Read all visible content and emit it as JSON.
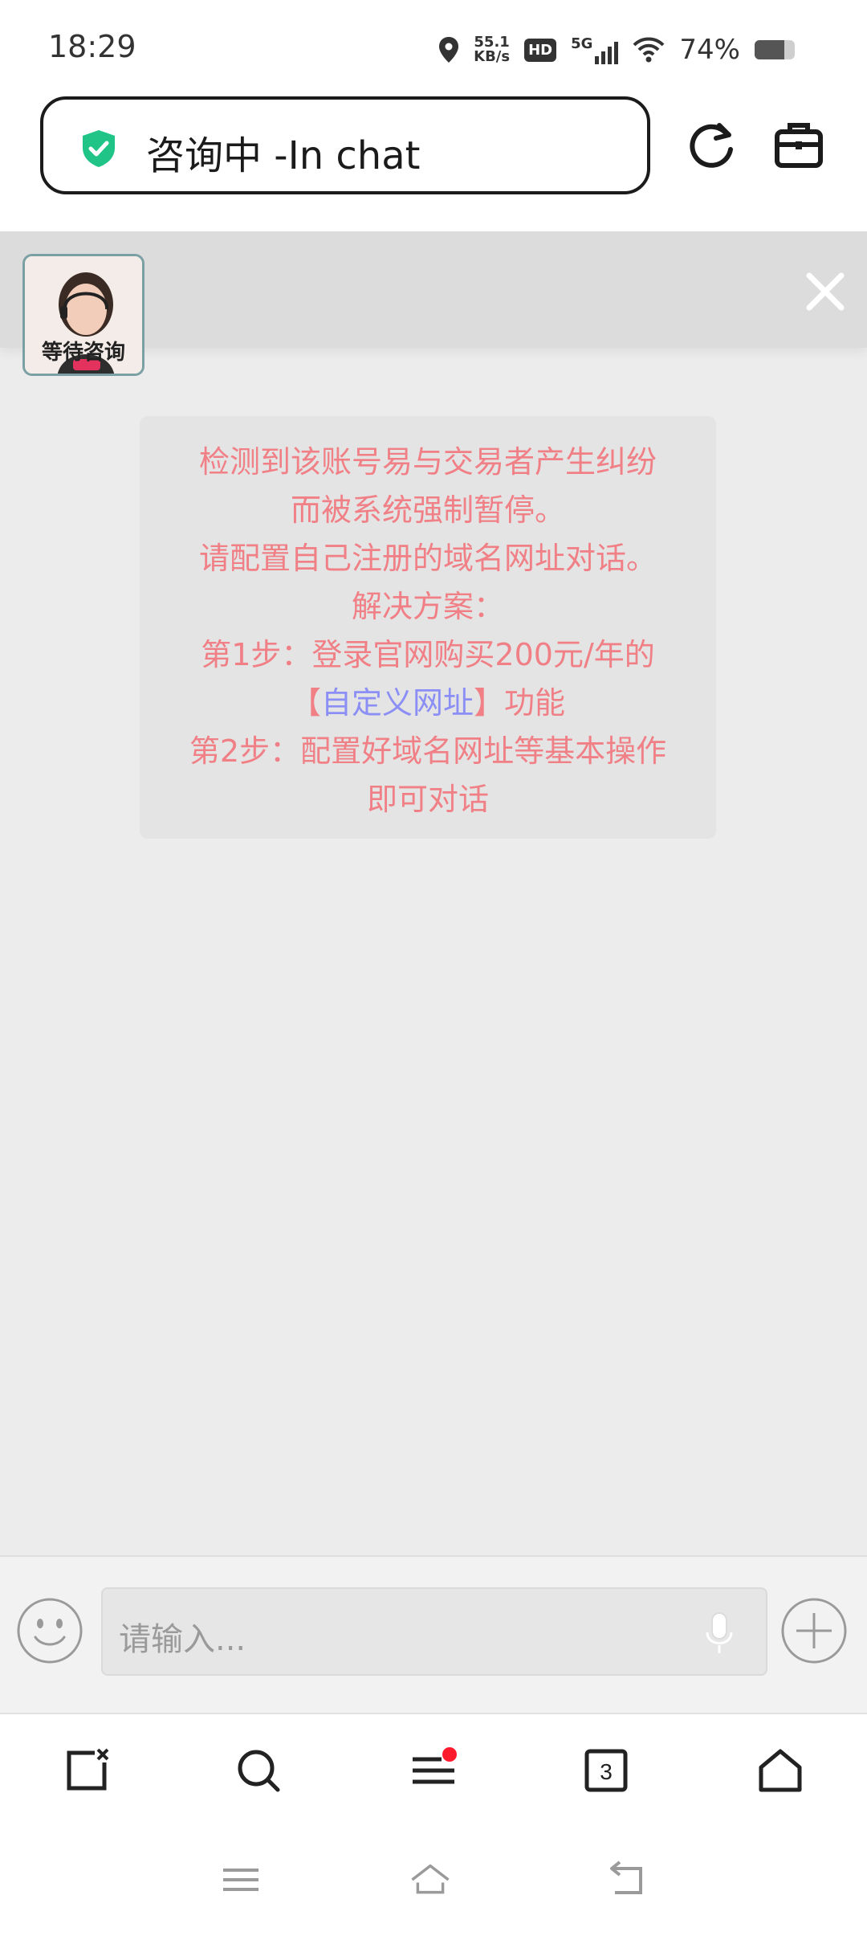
{
  "status_bar": {
    "time": "18:29",
    "speed_value": "55.1",
    "speed_unit": "KB/s",
    "hd_label": "HD",
    "network": "5G",
    "battery": "74%",
    "battery_level": 0.74
  },
  "toolbar": {
    "title": "咨询中 -In chat",
    "shield_color": "#1fc486",
    "refresh_icon": "refresh-icon",
    "toolbox_icon": "briefcase-icon"
  },
  "agent": {
    "avatar_label": "等待咨询",
    "close_icon": "close-icon"
  },
  "message": {
    "lines": [
      "检测到该账号易与交易者产生纠纷",
      "而被系统强制暂停。",
      "请配置自己注册的域名网址对话。",
      "解决方案：",
      "第1步：登录官网购买200元/年的",
      "功能",
      "第2步：配置好域名网址等基本操作",
      "即可对话"
    ],
    "bracket_open": "【",
    "link_text": "自定义网址",
    "bracket_close": "】",
    "text_color": "#f07f86",
    "link_color": "#8b8ff5"
  },
  "input": {
    "placeholder": "请输入...",
    "emoji_icon": "emoji-icon",
    "mic_icon": "microphone-icon",
    "plus_icon": "plus-icon"
  },
  "bottom_nav": {
    "tabs_count": "3",
    "items": [
      "close-tab-icon",
      "search-icon",
      "menu-icon",
      "tabs-icon",
      "home-icon"
    ],
    "badge_color": "#ff1a2e"
  },
  "system_nav": {
    "items": [
      "recent-apps-icon",
      "home-icon",
      "back-icon"
    ]
  }
}
